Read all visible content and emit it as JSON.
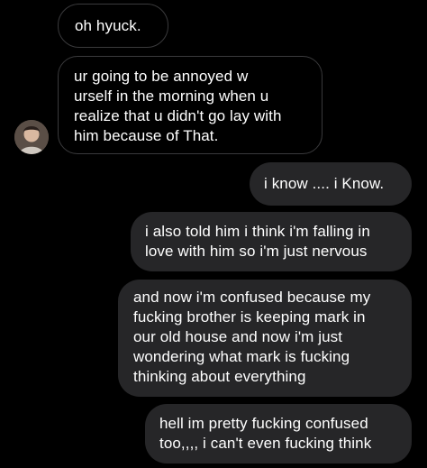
{
  "thread": {
    "messages": [
      {
        "id": "m1",
        "sender": "them",
        "text": "oh hyuck."
      },
      {
        "id": "m2",
        "sender": "them",
        "text": "ur going to be annoyed w\nurself in the morning when u\nrealize that u didn't go lay with\nhim because of That."
      },
      {
        "id": "m3",
        "sender": "me",
        "text": "i know .... i Know."
      },
      {
        "id": "m4",
        "sender": "me",
        "text": "i also told him i think i'm falling in\nlove with him so i'm just nervous"
      },
      {
        "id": "m5",
        "sender": "me",
        "text": "and now i'm confused because my\nfucking brother is keeping mark in\nour old house and now i'm just\nwondering what mark is fucking\nthinking about everything"
      },
      {
        "id": "m6",
        "sender": "me",
        "text": "hell im pretty fucking confused\ntoo,,,, i can't even fucking think"
      }
    ]
  },
  "colors": {
    "background": "#000000",
    "incoming_border": "#3a3a3c",
    "outgoing_bubble": "#262628",
    "text": "#ffffff"
  }
}
